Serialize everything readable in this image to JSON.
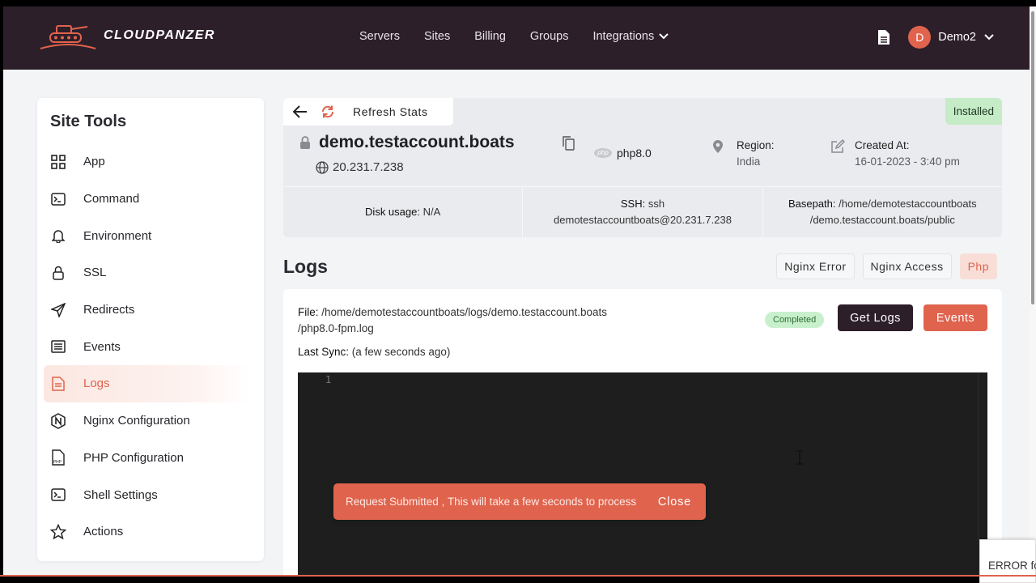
{
  "brand": {
    "name": "CLOUDPANZER"
  },
  "nav": {
    "items": [
      "Servers",
      "Sites",
      "Billing",
      "Groups"
    ],
    "integrations": "Integrations"
  },
  "user": {
    "initial": "D",
    "name": "Demo2"
  },
  "sidebar": {
    "title": "Site Tools",
    "items": [
      {
        "label": "App",
        "icon": "grid-icon"
      },
      {
        "label": "Command",
        "icon": "terminal-icon"
      },
      {
        "label": "Environment",
        "icon": "bell-icon"
      },
      {
        "label": "SSL",
        "icon": "lock-icon"
      },
      {
        "label": "Redirects",
        "icon": "paper-plane-icon"
      },
      {
        "label": "Events",
        "icon": "list-icon"
      },
      {
        "label": "Logs",
        "icon": "file-icon"
      },
      {
        "label": "Nginx Configuration",
        "icon": "nginx-icon"
      },
      {
        "label": "PHP Configuration",
        "icon": "php-file-icon"
      },
      {
        "label": "Shell Settings",
        "icon": "terminal-icon"
      },
      {
        "label": "Actions",
        "icon": "star-icon"
      }
    ],
    "active": "Logs"
  },
  "site": {
    "refresh_label": "Refresh Stats",
    "status": "Installed",
    "name": "demo.testaccount.boats",
    "ip": "20.231.7.238",
    "php": "php8.0",
    "php_badge": "php",
    "region_label": "Region:",
    "region_value": "India",
    "created_label": "Created At:",
    "created_value": "16-01-2023 - 3:40 pm",
    "disk_label": "Disk usage:",
    "disk_value": "N/A",
    "ssh_label": "SSH:",
    "ssh_value": "ssh demotestaccountboats@20.231.7.238",
    "basepath_label": "Basepath:",
    "basepath_value": "/home/demotestaccountboats /demo.testaccount.boats/public"
  },
  "logs": {
    "title": "Logs",
    "tabs": [
      "Nginx Error",
      "Nginx Access",
      "Php"
    ],
    "active_tab": "Php",
    "file_label": "File:",
    "file_value": "/home/demotestaccountboats/logs/demo.testaccount.boats /php8.0-fpm.log",
    "sync_label": "Last Sync:",
    "sync_value": "(a few seconds ago)",
    "status": "Completed",
    "get_logs": "Get Logs",
    "events": "Events",
    "line_number": "1"
  },
  "toast": {
    "message": "Request Submitted , This will take a few seconds to process",
    "close": "Close"
  },
  "error_box": {
    "text": "ERROR fo"
  },
  "colors": {
    "accent": "#e0634d",
    "header": "#2d1f2a",
    "success": "#c5ebc7"
  }
}
